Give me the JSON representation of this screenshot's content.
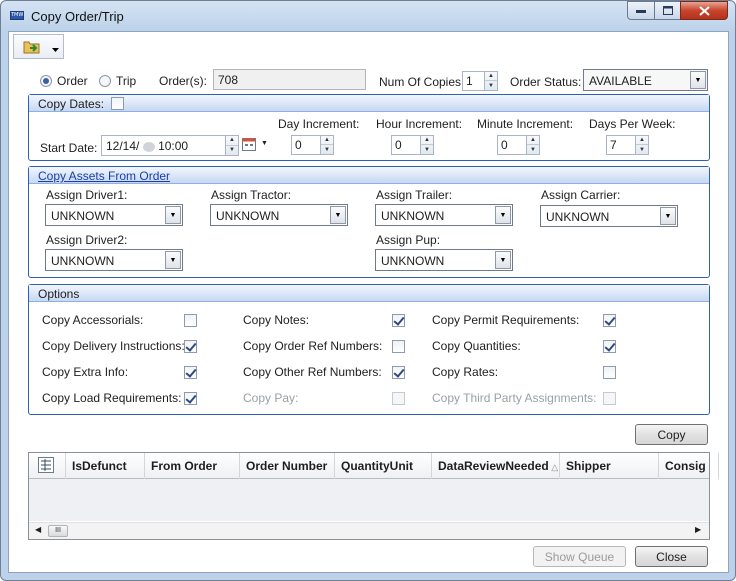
{
  "window": {
    "title": "Copy Order/Trip",
    "app_icon_text": "TMW"
  },
  "toolbar": {
    "icon": "folder-copy-icon"
  },
  "mode": {
    "order_label": "Order",
    "trip_label": "Trip",
    "selected": "Order"
  },
  "orders": {
    "label": "Order(s):",
    "value": "708"
  },
  "copies": {
    "label": "Num Of Copies:",
    "value": "1"
  },
  "status": {
    "label": "Order Status:",
    "value": "AVAILABLE"
  },
  "copy_dates": {
    "header": "Copy Dates:",
    "checked": false,
    "start_label": "Start Date:",
    "start_value": "12/14/",
    "start_time": "10:00",
    "day_label": "Day Increment:",
    "day_value": "0",
    "hour_label": "Hour Increment:",
    "hour_value": "0",
    "minute_label": "Minute Increment:",
    "minute_value": "0",
    "dpw_label": "Days Per Week:",
    "dpw_value": "7"
  },
  "assets": {
    "header": "Copy Assets From Order",
    "driver1_label": "Assign Driver1:",
    "driver1_value": "UNKNOWN",
    "tractor_label": "Assign Tractor:",
    "tractor_value": "UNKNOWN",
    "trailer_label": "Assign Trailer:",
    "trailer_value": "UNKNOWN",
    "carrier_label": "Assign Carrier:",
    "carrier_value": "UNKNOWN",
    "driver2_label": "Assign Driver2:",
    "driver2_value": "UNKNOWN",
    "pup_label": "Assign Pup:",
    "pup_value": "UNKNOWN"
  },
  "options": {
    "header": "Options",
    "items": [
      {
        "label": "Copy Accessorials:",
        "checked": false,
        "enabled": true
      },
      {
        "label": "Copy Delivery Instructions:",
        "checked": true,
        "enabled": true
      },
      {
        "label": "Copy Extra Info:",
        "checked": true,
        "enabled": true
      },
      {
        "label": "Copy Load Requirements:",
        "checked": true,
        "enabled": true
      },
      {
        "label": "Copy Notes:",
        "checked": true,
        "enabled": true
      },
      {
        "label": "Copy Order Ref Numbers:",
        "checked": false,
        "enabled": true
      },
      {
        "label": "Copy Other Ref Numbers:",
        "checked": true,
        "enabled": true
      },
      {
        "label": "Copy Pay:",
        "checked": false,
        "enabled": false
      },
      {
        "label": "Copy Permit Requirements:",
        "checked": true,
        "enabled": true
      },
      {
        "label": "Copy Quantities:",
        "checked": true,
        "enabled": true
      },
      {
        "label": "Copy Rates:",
        "checked": false,
        "enabled": true
      },
      {
        "label": "Copy Third Party Assignments:",
        "checked": false,
        "enabled": false
      }
    ]
  },
  "buttons": {
    "copy": "Copy",
    "show_queue": "Show Queue",
    "close": "Close"
  },
  "grid": {
    "columns": [
      "IsDefunct",
      "From Order",
      "Order Number",
      "QuantityUnit",
      "DataReviewNeeded",
      "Shipper",
      "Consig"
    ],
    "sorted_column": "DataReviewNeeded",
    "scroll_thumb": "III"
  }
}
